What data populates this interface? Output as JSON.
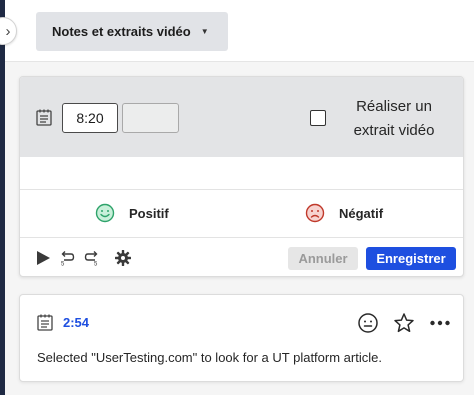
{
  "header": {
    "view_dropdown_label": "Notes et extraits vidéo",
    "collapse_icon": "chevron-right-icon"
  },
  "editor": {
    "start_time_value": "8:20",
    "end_time_value": "",
    "clip_checkbox_checked": false,
    "clip_label": "Réaliser un extrait vidéo",
    "note_text_value": "",
    "positive_label": "Positif",
    "negative_label": "Négatif",
    "cancel_label": "Annuler",
    "save_label": "Enregistrer",
    "tool_icons": [
      "play-icon",
      "rewind-icon",
      "forward-icon",
      "gear-icon"
    ]
  },
  "notes": [
    {
      "timestamp": "2:54",
      "text": "Selected \"UserTesting.com\" to look for a UT platform article.",
      "action_icons": [
        "react-icon",
        "star-icon",
        "more-icon"
      ]
    }
  ],
  "colors": {
    "accent": "#1e4fe0",
    "positive": "#2fa36b",
    "negative": "#c0392b",
    "rail": "#1f2a44"
  }
}
